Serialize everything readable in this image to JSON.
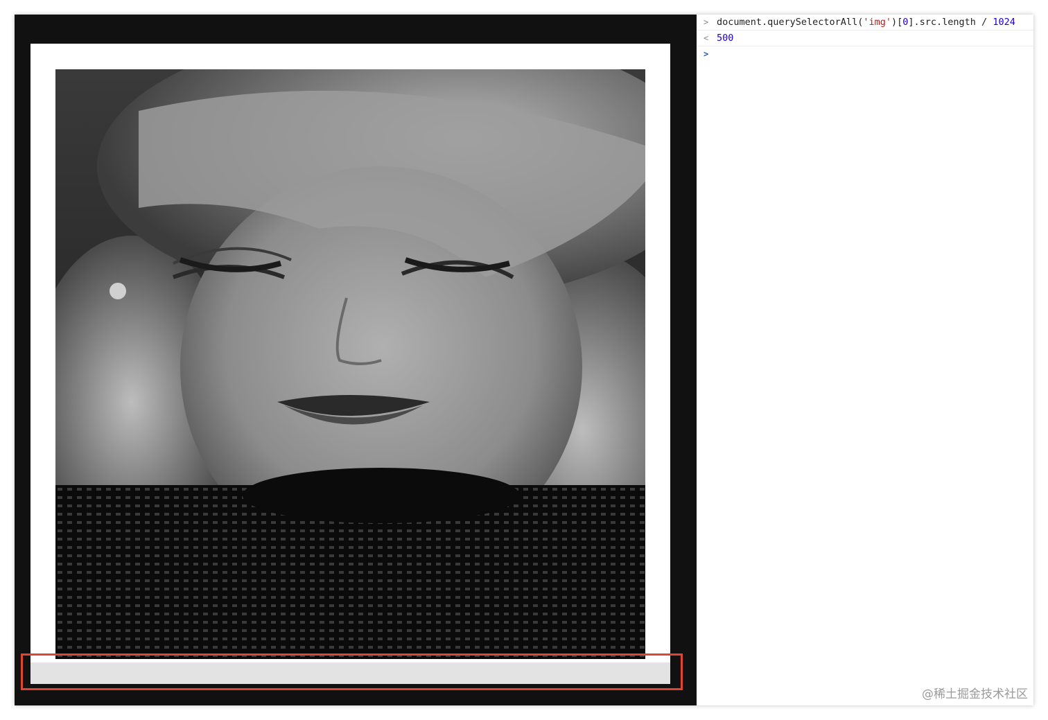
{
  "console": {
    "input_line": {
      "prompt": ">",
      "code_prefix": "document.querySelectorAll(",
      "string_literal": "'img'",
      "code_middle": ")[",
      "index": "0",
      "code_suffix": "].src.length ",
      "operator": "/",
      "divisor": "1024"
    },
    "output_line": {
      "prompt": "<",
      "value": "500"
    },
    "active_prompt": ">"
  },
  "watermark": "@稀土掘金技术社区",
  "colors": {
    "highlight_border": "#e0452f",
    "viewport_bg": "#111111",
    "string_color": "#c41a16",
    "number_color": "#1c00cf"
  }
}
